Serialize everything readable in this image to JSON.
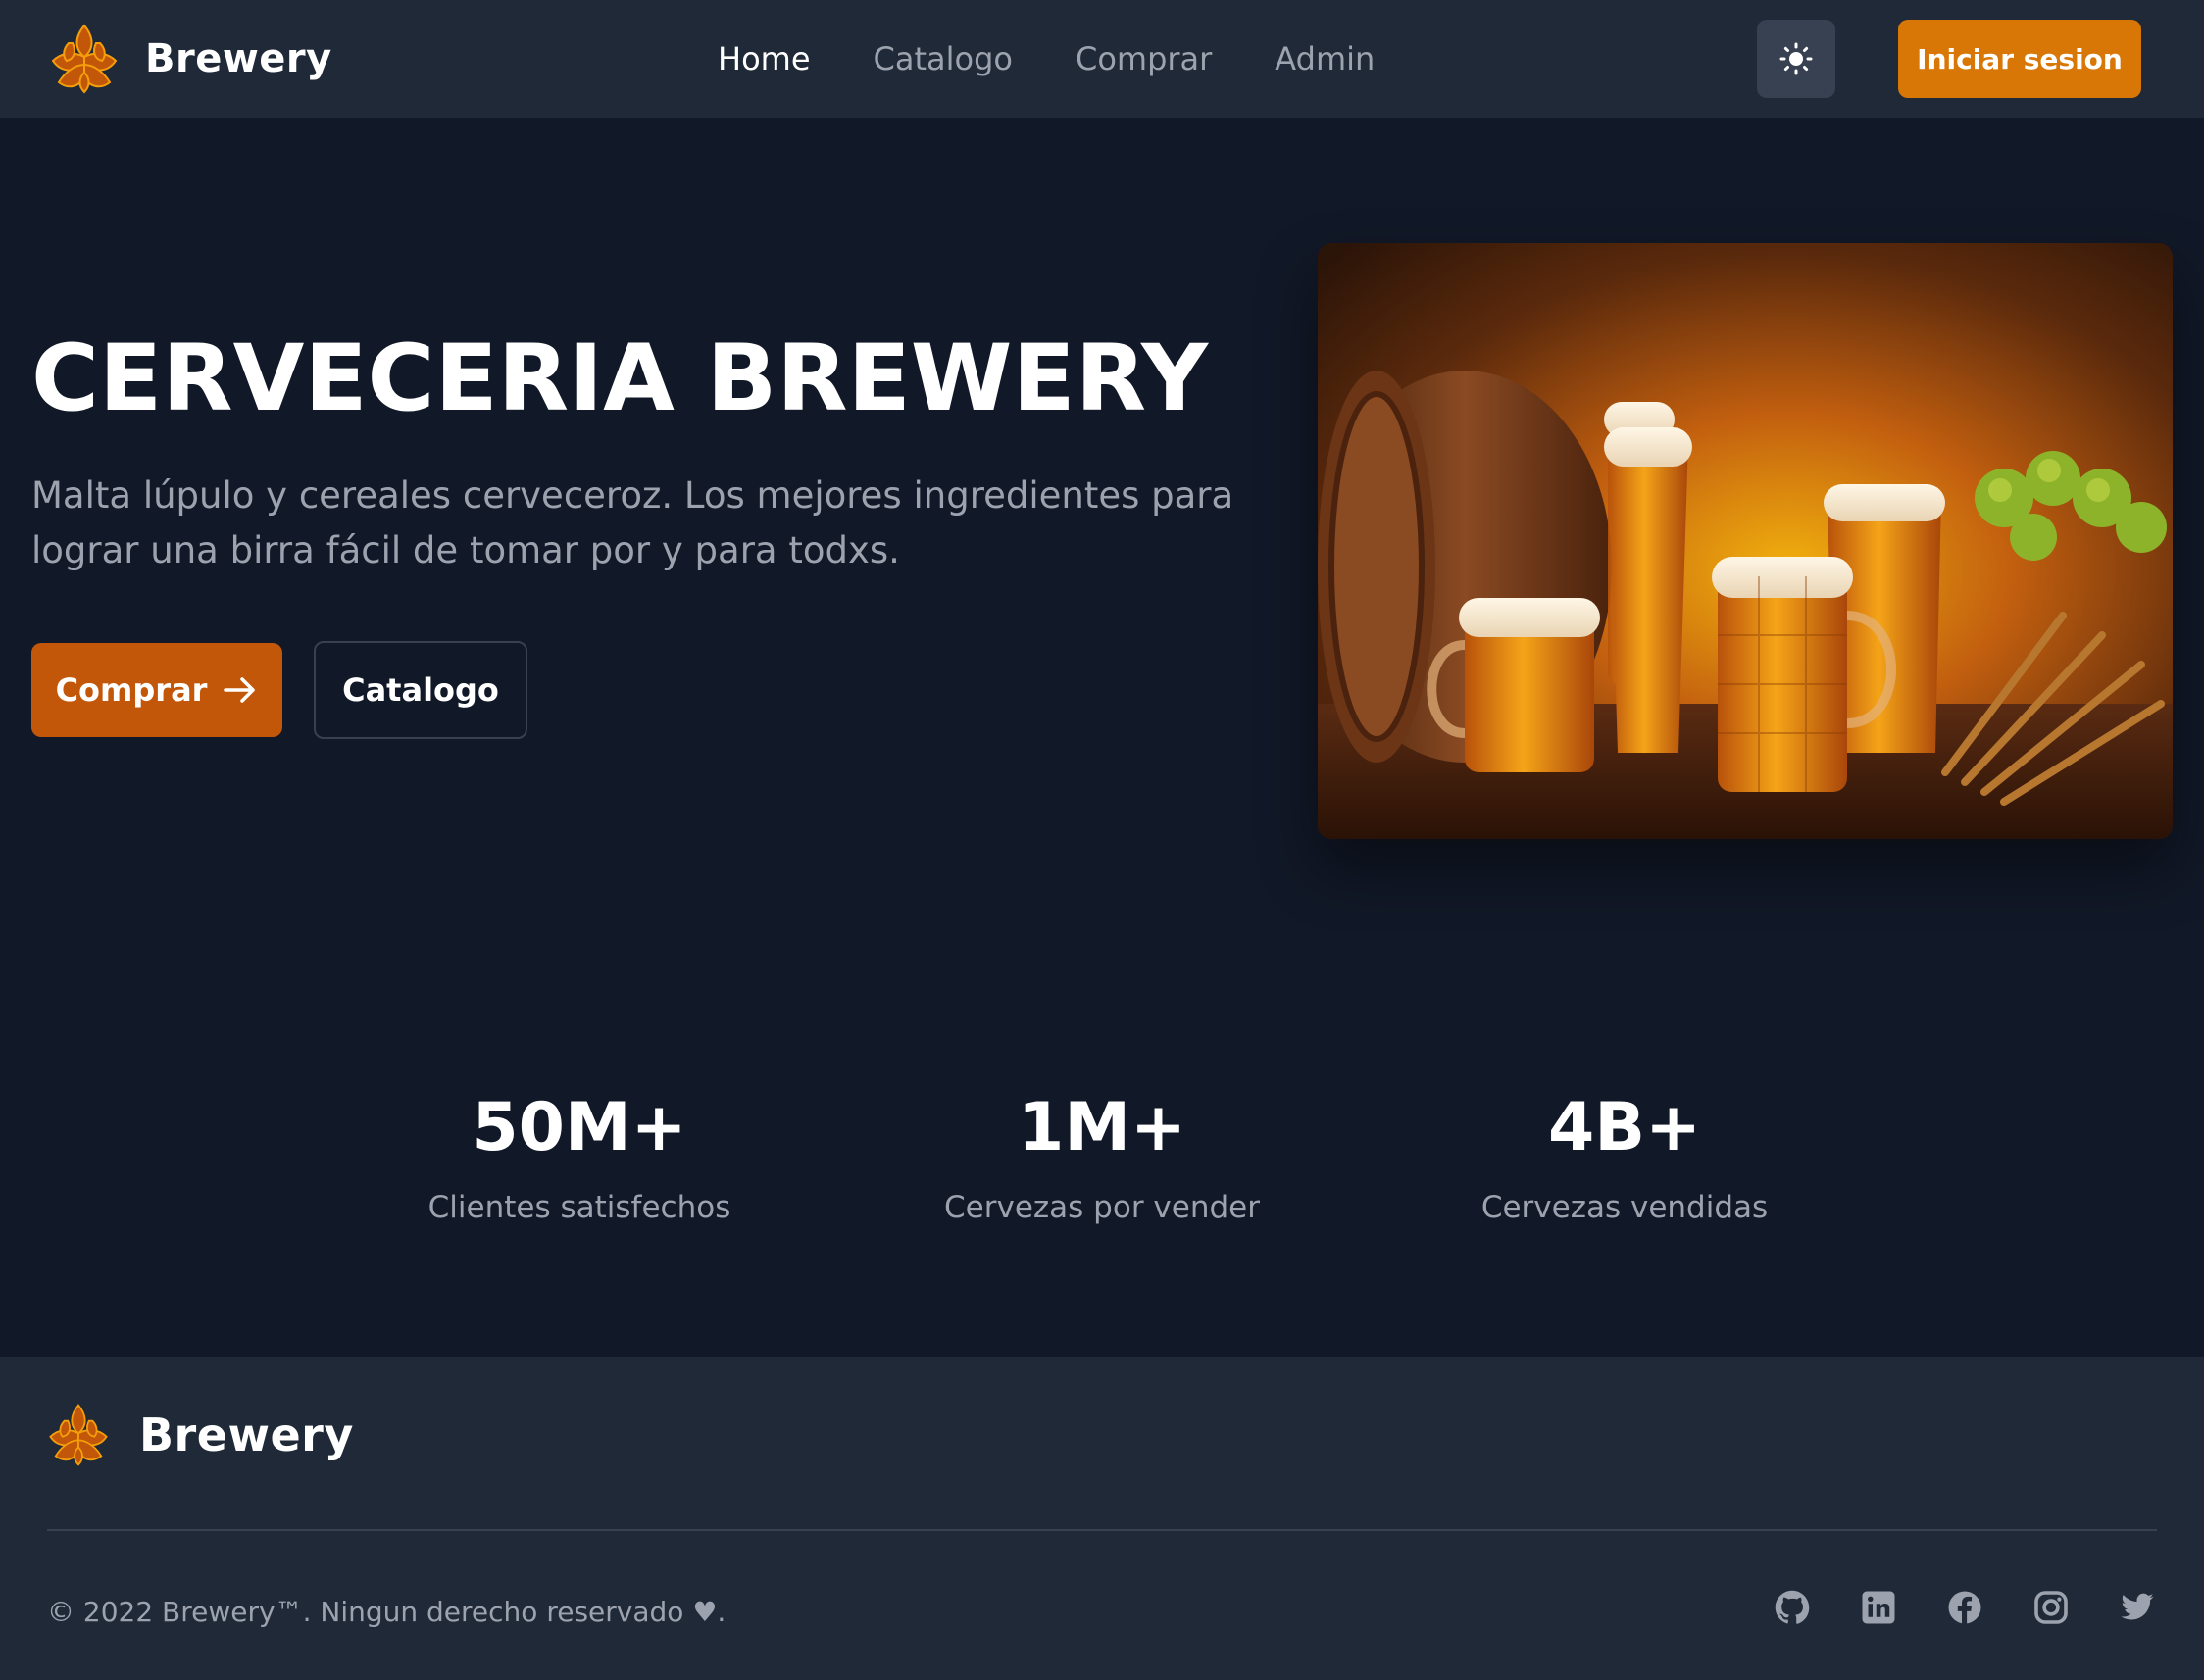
{
  "header": {
    "brand": "Brewery",
    "nav": [
      {
        "label": "Home",
        "active": true
      },
      {
        "label": "Catalogo",
        "active": false
      },
      {
        "label": "Comprar",
        "active": false
      },
      {
        "label": "Admin",
        "active": false
      }
    ],
    "theme_toggle_icon": "sun-icon",
    "login_label": "Iniciar sesion"
  },
  "hero": {
    "title": "CERVECERIA BREWERY",
    "subtitle": "Malta lúpulo y cereales cerveceroz. Los mejores ingredientes para lograr una birra fácil de tomar por y para todxs.",
    "primary_button": "Comprar",
    "secondary_button": "Catalogo"
  },
  "stats": [
    {
      "value": "50M+",
      "label": "Clientes satisfechos"
    },
    {
      "value": "1M+",
      "label": "Cervezas por vender"
    },
    {
      "value": "4B+",
      "label": "Cervezas vendidas"
    }
  ],
  "footer": {
    "brand": "Brewery",
    "copyright": "© 2022 Brewery™. Ningun derecho reservado ♥.",
    "socials": [
      "github-icon",
      "linkedin-icon",
      "facebook-icon",
      "instagram-icon",
      "twitter-icon"
    ]
  },
  "colors": {
    "background": "#111827",
    "surface": "#1f2937",
    "accent": "#d97706",
    "accent_dark": "#c2570a",
    "muted_text": "#9ca3af"
  }
}
